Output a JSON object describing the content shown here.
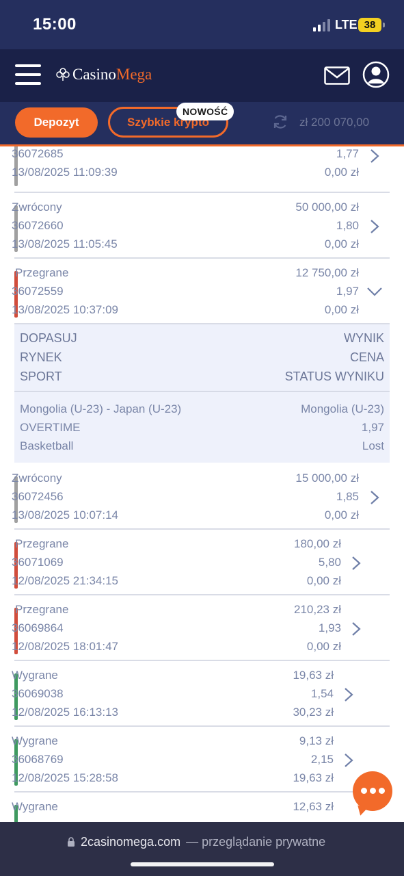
{
  "status_bar": {
    "time": "15:00",
    "network": "LTE",
    "battery": "38"
  },
  "header": {
    "logo_casino": "Casino",
    "logo_mega": "Mega"
  },
  "actions": {
    "deposit": "Depozyt",
    "crypto": "Szybkie krypto",
    "new_badge": "NOWOŚĆ",
    "balance": "zł 200 070,00"
  },
  "bets": [
    {
      "status": "",
      "id": "36072685",
      "date": "13/08/2025 11:09:39",
      "stake": "",
      "odds": "1,77",
      "win": "0,00 zł",
      "color": "#a0a0a0"
    },
    {
      "status": "Zwrócony",
      "id": "36072660",
      "date": "13/08/2025 11:05:45",
      "stake": "50 000,00 zł",
      "odds": "1,80",
      "win": "0,00 zł",
      "color": "#a0a0a0"
    },
    {
      "status": "Przegrane",
      "id": "36072559",
      "date": "13/08/2025 10:37:09",
      "stake": "12 750,00 zł",
      "odds": "1,97",
      "win": "0,00 zł",
      "color": "#d14d3c"
    },
    {
      "status": "Zwrócony",
      "id": "36072456",
      "date": "13/08/2025 10:07:14",
      "stake": "15 000,00 zł",
      "odds": "1,85",
      "win": "0,00 zł",
      "color": "#a0a0a0"
    },
    {
      "status": "Przegrane",
      "id": "36071069",
      "date": "12/08/2025 21:34:15",
      "stake": "180,00 zł",
      "odds": "5,80",
      "win": "0,00 zł",
      "color": "#d14d3c"
    },
    {
      "status": "Przegrane",
      "id": "36069864",
      "date": "12/08/2025 18:01:47",
      "stake": "210,23 zł",
      "odds": "1,93",
      "win": "0,00 zł",
      "color": "#d14d3c"
    },
    {
      "status": "Wygrane",
      "id": "36069038",
      "date": "12/08/2025 16:13:13",
      "stake": "19,63 zł",
      "odds": "1,54",
      "win": "30,23 zł",
      "color": "#3f9a60"
    },
    {
      "status": "Wygrane",
      "id": "36068769",
      "date": "12/08/2025 15:28:58",
      "stake": "9,13 zł",
      "odds": "2,15",
      "win": "19,63 zł",
      "color": "#3f9a60"
    },
    {
      "status": "Wygrane",
      "id": "",
      "date": "",
      "stake": "12,63 zł",
      "odds": "",
      "win": "",
      "color": "#3f9a60"
    }
  ],
  "detail": {
    "headers": {
      "match": "DOPASUJ",
      "market": "RYNEK",
      "sport": "SPORT",
      "result": "WYNIK",
      "price": "CENA",
      "result_status": "STATUS WYNIKU"
    },
    "values": {
      "match": "Mongolia (U-23) - Japan (U-23)",
      "market": "OVERTIME",
      "sport": "Basketball",
      "result": "Mongolia (U-23)",
      "price": "1,97",
      "result_status": "Lost"
    }
  },
  "browser": {
    "url": "2casinomega.com",
    "mode": "— przeglądanie prywatne"
  }
}
